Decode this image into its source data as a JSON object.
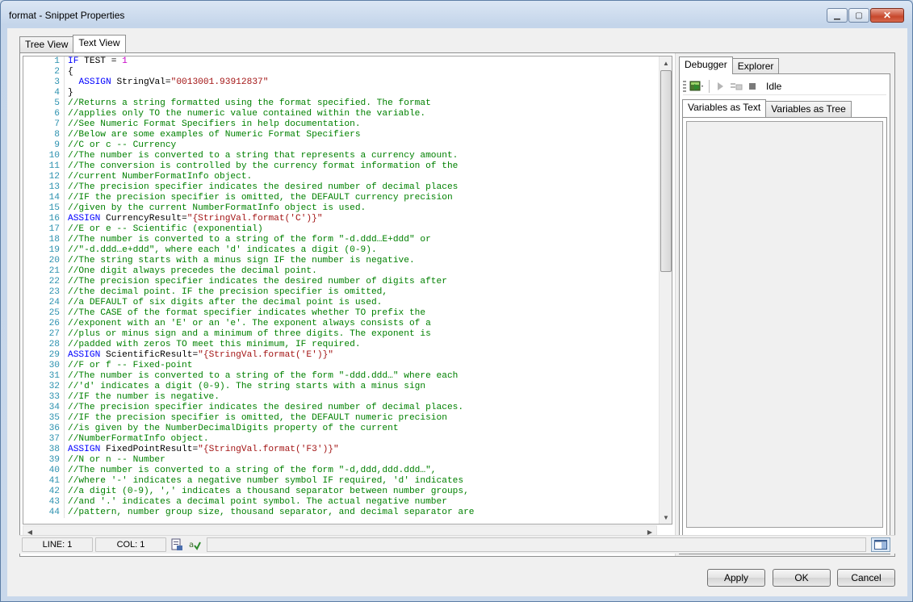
{
  "window": {
    "title": "format - Snippet Properties"
  },
  "outer_tabs": [
    {
      "label": "Tree View",
      "active": false
    },
    {
      "label": "Text View",
      "active": true
    }
  ],
  "code_lines": [
    {
      "n": "1",
      "k": "c",
      "t": "IF TEST = 1"
    },
    {
      "n": "2",
      "k": "c",
      "t": "{"
    },
    {
      "n": "3",
      "k": "c",
      "t": "  ASSIGN StringVal=\"0013001.93912837\""
    },
    {
      "n": "4",
      "k": "c",
      "t": "}"
    },
    {
      "n": "5",
      "k": "g",
      "t": "//Returns a string formatted using the format specified. The format"
    },
    {
      "n": "6",
      "k": "g",
      "t": "//applies only TO the numeric value contained within the variable."
    },
    {
      "n": "7",
      "k": "g",
      "t": "//See Numeric Format Specifiers in help documentation."
    },
    {
      "n": "8",
      "k": "g",
      "t": "//Below are some examples of Numeric Format Specifiers"
    },
    {
      "n": "9",
      "k": "g",
      "t": "//C or c -- Currency"
    },
    {
      "n": "10",
      "k": "g",
      "t": "//The number is converted to a string that represents a currency amount."
    },
    {
      "n": "11",
      "k": "g",
      "t": "//The conversion is controlled by the currency format information of the"
    },
    {
      "n": "12",
      "k": "g",
      "t": "//current NumberFormatInfo object."
    },
    {
      "n": "13",
      "k": "g",
      "t": "//The precision specifier indicates the desired number of decimal places"
    },
    {
      "n": "14",
      "k": "g",
      "t": "//IF the precision specifier is omitted, the DEFAULT currency precision"
    },
    {
      "n": "15",
      "k": "g",
      "t": "//given by the current NumberFormatInfo object is used."
    },
    {
      "n": "16",
      "k": "c",
      "t": "ASSIGN CurrencyResult=\"{StringVal.format('C')}\""
    },
    {
      "n": "17",
      "k": "g",
      "t": "//E or e -- Scientific (exponential)"
    },
    {
      "n": "18",
      "k": "g",
      "t": "//The number is converted to a string of the form \"-d.ddd…E+ddd\" or"
    },
    {
      "n": "19",
      "k": "g",
      "t": "//\"-d.ddd…e+ddd\", where each 'd' indicates a digit (0-9)."
    },
    {
      "n": "20",
      "k": "g",
      "t": "//The string starts with a minus sign IF the number is negative."
    },
    {
      "n": "21",
      "k": "g",
      "t": "//One digit always precedes the decimal point."
    },
    {
      "n": "22",
      "k": "g",
      "t": "//The precision specifier indicates the desired number of digits after"
    },
    {
      "n": "23",
      "k": "g",
      "t": "//the decimal point. IF the precision specifier is omitted,"
    },
    {
      "n": "24",
      "k": "g",
      "t": "//a DEFAULT of six digits after the decimal point is used."
    },
    {
      "n": "25",
      "k": "g",
      "t": "//The CASE of the format specifier indicates whether TO prefix the"
    },
    {
      "n": "26",
      "k": "g",
      "t": "//exponent with an 'E' or an 'e'. The exponent always consists of a"
    },
    {
      "n": "27",
      "k": "g",
      "t": "//plus or minus sign and a minimum of three digits. The exponent is"
    },
    {
      "n": "28",
      "k": "g",
      "t": "//padded with zeros TO meet this minimum, IF required."
    },
    {
      "n": "29",
      "k": "c",
      "t": "ASSIGN ScientificResult=\"{StringVal.format('E')}\""
    },
    {
      "n": "30",
      "k": "g",
      "t": "//F or f -- Fixed-point"
    },
    {
      "n": "31",
      "k": "g",
      "t": "//The number is converted to a string of the form \"-ddd.ddd…\" where each"
    },
    {
      "n": "32",
      "k": "g",
      "t": "//'d' indicates a digit (0-9). The string starts with a minus sign"
    },
    {
      "n": "33",
      "k": "g",
      "t": "//IF the number is negative."
    },
    {
      "n": "34",
      "k": "g",
      "t": "//The precision specifier indicates the desired number of decimal places."
    },
    {
      "n": "35",
      "k": "g",
      "t": "//IF the precision specifier is omitted, the DEFAULT numeric precision"
    },
    {
      "n": "36",
      "k": "g",
      "t": "//is given by the NumberDecimalDigits property of the current"
    },
    {
      "n": "37",
      "k": "g",
      "t": "//NumberFormatInfo object."
    },
    {
      "n": "38",
      "k": "c",
      "t": "ASSIGN FixedPointResult=\"{StringVal.format('F3')}\""
    },
    {
      "n": "39",
      "k": "g",
      "t": "//N or n -- Number"
    },
    {
      "n": "40",
      "k": "g",
      "t": "//The number is converted to a string of the form \"-d,ddd,ddd.ddd…\","
    },
    {
      "n": "41",
      "k": "g",
      "t": "//where '-' indicates a negative number symbol IF required, 'd' indicates"
    },
    {
      "n": "42",
      "k": "g",
      "t": "//a digit (0-9), ',' indicates a thousand separator between number groups,"
    },
    {
      "n": "43",
      "k": "g",
      "t": "//and '.' indicates a decimal point symbol. The actual negative number"
    },
    {
      "n": "44",
      "k": "g",
      "t": "//pattern, number group size, thousand separator, and decimal separator are"
    }
  ],
  "right_panel": {
    "tabs": [
      {
        "label": "Debugger",
        "active": true
      },
      {
        "label": "Explorer",
        "active": false
      }
    ],
    "status": "Idle",
    "sub_tabs": [
      {
        "label": "Variables as Text",
        "active": true
      },
      {
        "label": "Variables as Tree",
        "active": false
      }
    ]
  },
  "statusbar": {
    "line": "LINE: 1",
    "col": "COL: 1"
  },
  "buttons": {
    "apply": "Apply",
    "ok": "OK",
    "cancel": "Cancel"
  },
  "colors": {
    "comment": "#008000",
    "keyword": "#0000ff",
    "string": "#a31515",
    "line_number": "#2b91af"
  },
  "icons": [
    "minimize-icon",
    "maximize-icon",
    "close-icon",
    "run-icon",
    "step-icon",
    "stop-icon",
    "evaluate-icon",
    "validate-icon",
    "panel-toggle-icon"
  ]
}
